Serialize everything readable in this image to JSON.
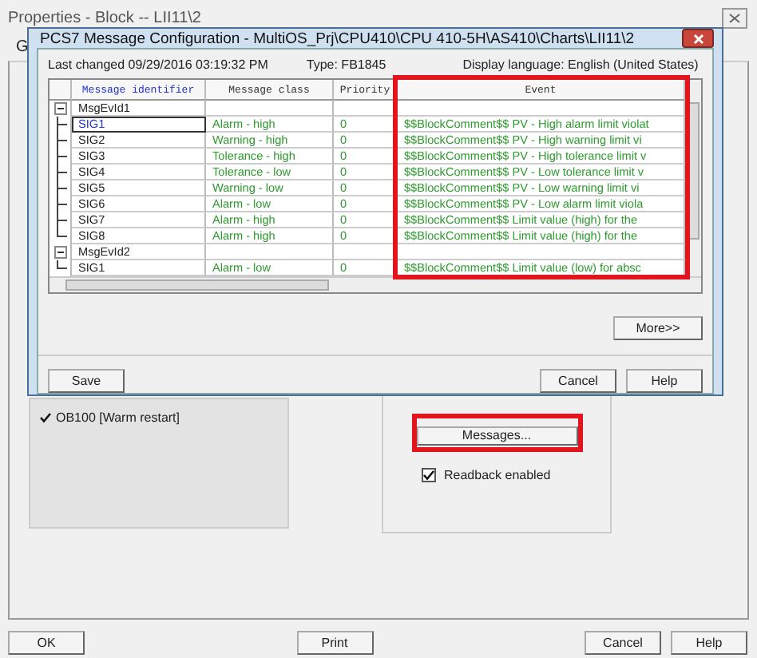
{
  "window": {
    "title": "Properties - Block -- LII11\\2",
    "tab_label": "G"
  },
  "run_sequence": [
    {
      "label": "OB100 [Warm restart]",
      "checked": true
    }
  ],
  "messages_button": {
    "label": "Messages...",
    "highlighted": true
  },
  "readback": {
    "label": "Readback enabled",
    "checked": true
  },
  "buttons": [
    "OK",
    "Print",
    "Cancel",
    "Help"
  ],
  "dialog": {
    "title": "PCS7 Message Configuration - MultiOS_Prj\\CPU410\\CPU 410-5H\\AS410\\Charts\\LII11\\2",
    "last_changed": "Last changed 09/29/2016 03:19:32 PM",
    "type": "Type: FB1845",
    "language": "Display language: English (United States)",
    "columns": [
      {
        "label": "Message identifier",
        "sorted": true,
        "highlighted": false
      },
      {
        "label": "Message class",
        "sorted": false,
        "highlighted": false
      },
      {
        "label": "Priority",
        "sorted": false,
        "highlighted": false
      },
      {
        "label": "Event",
        "sorted": false,
        "highlighted": true
      }
    ],
    "groups": [
      {
        "label": "MsgEvId1",
        "expanded": true,
        "children": [
          {
            "id": "SIG1",
            "class": "Alarm - high",
            "priority": "0",
            "event": "$$BlockComment$$ PV - High alarm limit violat",
            "selected": true
          },
          {
            "id": "SIG2",
            "class": "Warning - high",
            "priority": "0",
            "event": "$$BlockComment$$ PV - High warning limit vi",
            "selected": false
          },
          {
            "id": "SIG3",
            "class": "Tolerance - high",
            "priority": "0",
            "event": "$$BlockComment$$ PV - High tolerance limit v",
            "selected": false
          },
          {
            "id": "SIG4",
            "class": "Tolerance - low",
            "priority": "0",
            "event": "$$BlockComment$$ PV - Low tolerance limit v",
            "selected": false
          },
          {
            "id": "SIG5",
            "class": "Warning - low",
            "priority": "0",
            "event": "$$BlockComment$$ PV - Low warning limit vi",
            "selected": false
          },
          {
            "id": "SIG6",
            "class": "Alarm - low",
            "priority": "0",
            "event": "$$BlockComment$$ PV - Low alarm limit viola",
            "selected": false
          },
          {
            "id": "SIG7",
            "class": "Alarm - high",
            "priority": "0",
            "event": "$$BlockComment$$ Limit value (high) for the",
            "selected": false
          },
          {
            "id": "SIG8",
            "class": "Alarm - high",
            "priority": "0",
            "event": "$$BlockComment$$ Limit value (high) for the",
            "selected": false
          }
        ]
      },
      {
        "label": "MsgEvId2",
        "expanded": true,
        "children": [
          {
            "id": "SIG1",
            "class": "Alarm - low",
            "priority": "0",
            "event": "$$BlockComment$$ Limit value (low) for absc",
            "selected": false
          }
        ]
      }
    ],
    "more_button": "More>>",
    "buttons": [
      "Save",
      "Cancel",
      "Help"
    ]
  }
}
